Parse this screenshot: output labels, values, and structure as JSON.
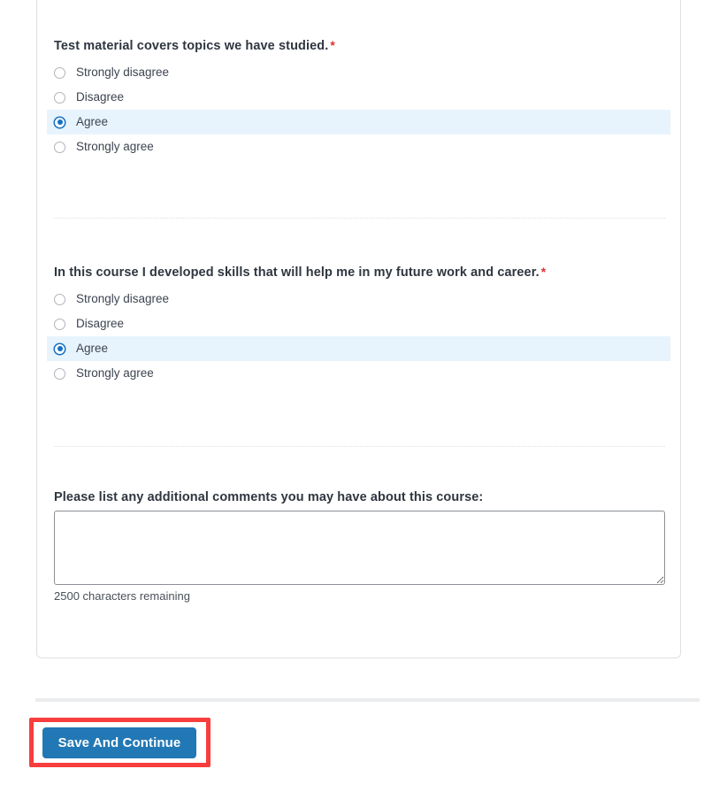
{
  "theme": {
    "accent_blue": "#2278b5",
    "radio_selected_blue": "#1471c4",
    "selected_row_bg": "#e8f4fd",
    "required_star_color": "#e03131",
    "annotation_red": "#f83d3d",
    "card_border": "#dddfe2",
    "separator": "#dcdee1"
  },
  "questions": [
    {
      "text": "Test material covers topics we have studied.",
      "required_marker": "*",
      "options": [
        {
          "label": "Strongly disagree",
          "selected": false
        },
        {
          "label": "Disagree",
          "selected": false
        },
        {
          "label": "Agree",
          "selected": true
        },
        {
          "label": "Strongly agree",
          "selected": false
        }
      ]
    },
    {
      "text": "In this course I developed skills that will help me in my future work and career.",
      "required_marker": "*",
      "options": [
        {
          "label": "Strongly disagree",
          "selected": false
        },
        {
          "label": "Disagree",
          "selected": false
        },
        {
          "label": "Agree",
          "selected": true
        },
        {
          "label": "Strongly agree",
          "selected": false
        }
      ]
    }
  ],
  "comment_question": {
    "label": "Please list any additional comments you may have about this course:",
    "value": "",
    "placeholder": "",
    "char_counter": "2500 characters remaining"
  },
  "footer": {
    "save_button_label": "Save And Continue"
  }
}
